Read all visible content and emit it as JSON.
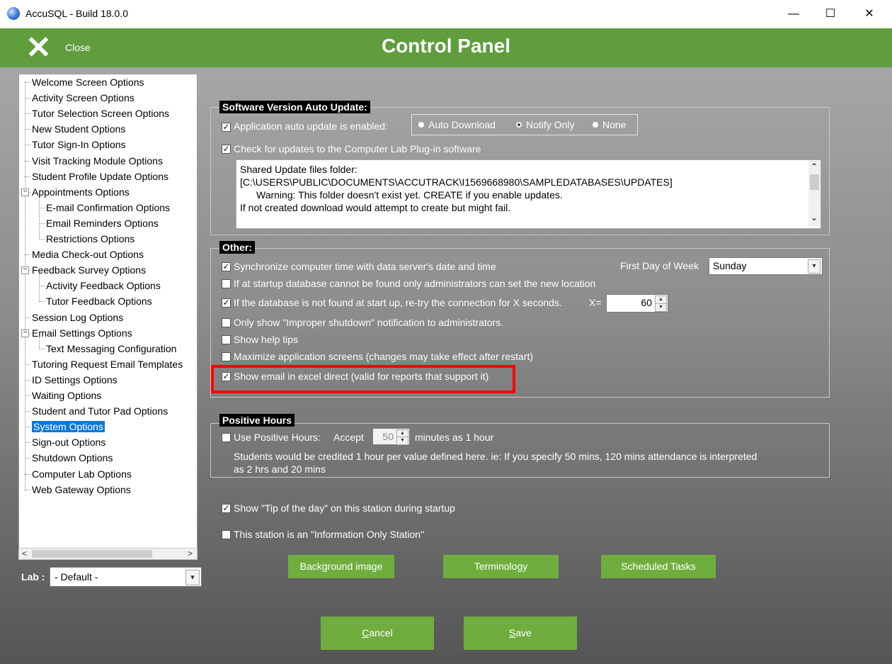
{
  "window": {
    "title": "AccuSQL - Build 18.0.0",
    "minimize": "—",
    "maximize": "☐",
    "close": "✕"
  },
  "header": {
    "close_icon": "✕",
    "close_label": "Close",
    "title": "Control Panel"
  },
  "tree": {
    "items": [
      {
        "label": "Welcome Screen Options"
      },
      {
        "label": "Activity Screen Options"
      },
      {
        "label": "Tutor Selection Screen Options"
      },
      {
        "label": "New Student Options"
      },
      {
        "label": "Tutor Sign-In Options"
      },
      {
        "label": "Visit Tracking Module Options"
      },
      {
        "label": "Student Profile Update Options"
      },
      {
        "label": "Appointments Options"
      },
      {
        "label": "E-mail Confirmation Options"
      },
      {
        "label": "Email Reminders Options"
      },
      {
        "label": "Restrictions Options"
      },
      {
        "label": "Media Check-out Options"
      },
      {
        "label": "Feedback Survey Options"
      },
      {
        "label": "Activity Feedback Options"
      },
      {
        "label": "Tutor Feedback Options"
      },
      {
        "label": "Session Log Options"
      },
      {
        "label": "Email Settings Options"
      },
      {
        "label": "Text Messaging Configuration"
      },
      {
        "label": "Tutoring Request Email Templates"
      },
      {
        "label": "ID Settings Options"
      },
      {
        "label": "Waiting Options"
      },
      {
        "label": "Student and Tutor Pad Options"
      },
      {
        "label": "System Options"
      },
      {
        "label": "Sign-out Options"
      },
      {
        "label": "Shutdown Options"
      },
      {
        "label": "Computer Lab Options"
      },
      {
        "label": "Web Gateway Options"
      }
    ],
    "expander_minus": "−",
    "scroll_left": "<",
    "scroll_right": ">"
  },
  "lab": {
    "label": "Lab :",
    "value": "- Default -",
    "dropdown_icon": "▾"
  },
  "software_update": {
    "legend": "Software Version Auto Update:",
    "auto_update_label": "Application auto update is enabled:",
    "radio_options": [
      "Auto Download",
      "Notify Only",
      "None"
    ],
    "selected_radio": "Notify Only",
    "check_lab_plugin_label": "Check for updates to the Computer Lab Plug-in software",
    "notes": [
      "Shared Update files folder:",
      "[C:\\USERS\\PUBLIC\\DOCUMENTS\\ACCUTRACK\\I1569668980\\SAMPLEDATABASES\\UPDATES]",
      "      Warning: This folder doesn't exist yet. CREATE if you enable updates.",
      "If not created download would attempt to create but might fail."
    ],
    "scroll_up": "⌃",
    "scroll_down": "⌄"
  },
  "other": {
    "legend": "Other:",
    "sync_time_label": "Synchronize computer time with data server's date and time",
    "first_day_label": "First Day of Week",
    "first_day_value": "Sunday",
    "admin_only_label": "If at startup database cannot be found only administrators can set the new location",
    "retry_label": "If the database is not found at start up, re-try the connection for X seconds.",
    "x_label": "X=",
    "x_value": "60",
    "improper_shutdown_label": "Only show \"Improper shutdown\" notification to administrators.",
    "help_tips_label": "Show help tips",
    "maximize_label": "Maximize application screens (changes may take effect after restart)",
    "email_excel_label": "Show email in excel direct (valid for reports that support it)"
  },
  "positive_hours": {
    "legend": "Positive Hours",
    "use_label": "Use Positive Hours:",
    "accept_label": "Accept",
    "accept_value": "50",
    "minutes_label": "minutes as 1 hour",
    "desc_line1": "Students would be credited 1 hour per value defined here. ie: If you specify 50 mins, 120 mins attendance is interpreted",
    "desc_line2": "as 2 hrs and 20 mins"
  },
  "tip_of_day_label": "Show \"Tip of the day\" on this station  during startup",
  "info_station_label": "This station is an \"Information Only Station\"",
  "buttons": {
    "background_image": "Background image",
    "terminology": "Terminology",
    "scheduled_tasks": "Scheduled Tasks",
    "cancel_prefix": "C",
    "cancel_rest": "ancel",
    "save_prefix": "S",
    "save_rest": "ave"
  },
  "check_mark": "✓",
  "spin_up": "▲",
  "spin_down": "▼",
  "colors": {
    "header_green": "#5f9d3d",
    "button_green": "#6fae3e",
    "selection_blue": "#0b78d7",
    "highlight_red": "#ff0000"
  }
}
